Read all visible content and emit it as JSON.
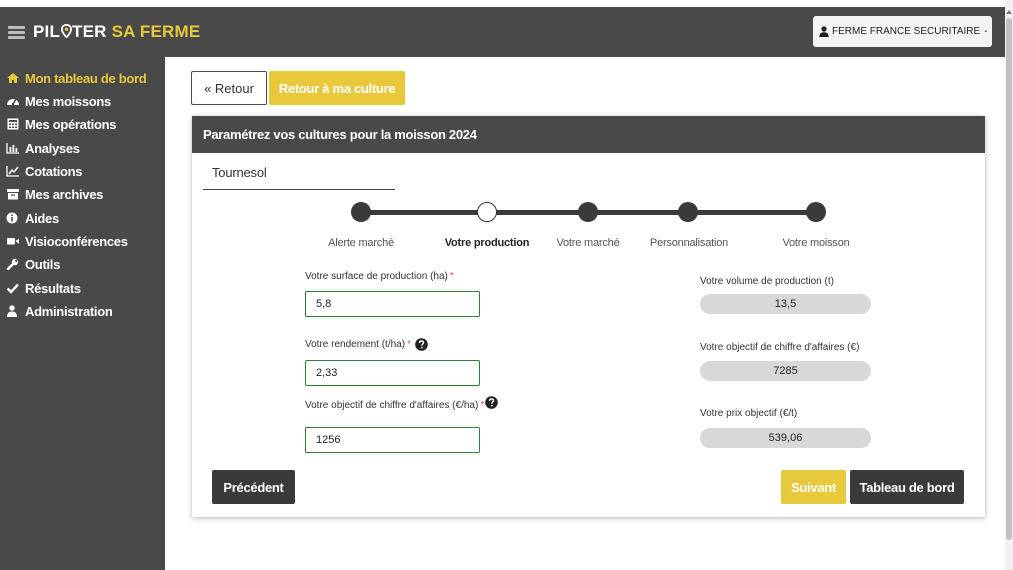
{
  "app": {
    "logo_part1": "PIL",
    "logo_part2": "TER",
    "logo_part3": "SA FERME",
    "user_label": "FERME FRANCE SECURITAIRE",
    "user_caret": "-"
  },
  "sidebar": {
    "items": [
      {
        "label": "Mon tableau de bord",
        "icon": "home-icon"
      },
      {
        "label": "Mes moissons",
        "icon": "dashboard-icon"
      },
      {
        "label": "Mes opérations",
        "icon": "calculator-icon"
      },
      {
        "label": "Analyses",
        "icon": "bar-chart-icon"
      },
      {
        "label": "Cotations",
        "icon": "line-chart-icon"
      },
      {
        "label": "Mes archives",
        "icon": "archive-icon"
      },
      {
        "label": "Aides",
        "icon": "info-icon"
      },
      {
        "label": "Visioconférences",
        "icon": "video-icon"
      },
      {
        "label": "Outils",
        "icon": "wrench-icon"
      },
      {
        "label": "Résultats",
        "icon": "check-icon"
      },
      {
        "label": "Administration",
        "icon": "user-icon"
      }
    ]
  },
  "nav": {
    "back_label": "« Retour",
    "back_to_crop_label": "Retour à ma culture"
  },
  "card": {
    "title": "Paramétrez vos cultures pour la moisson 2024",
    "crop_tab": "Tournesol"
  },
  "steps": [
    {
      "label": "Alerte marché",
      "state": "done"
    },
    {
      "label": "Votre production",
      "state": "current"
    },
    {
      "label": "Votre marché",
      "state": "done"
    },
    {
      "label": "Personnalisation",
      "state": "done"
    },
    {
      "label": "Votre moisson",
      "state": "done"
    }
  ],
  "form": {
    "surface": {
      "label": "Votre surface de production (ha)",
      "required": "*",
      "value": "5,8"
    },
    "rendement": {
      "label": "Votre rendement (t/ha)",
      "required": "*",
      "value": "2,33"
    },
    "objectif_ca_ha": {
      "label": "Votre objectif de chiffre d'affaires (€/ha)",
      "required": "*",
      "value": "1256"
    }
  },
  "outputs": {
    "volume": {
      "label": "Votre volume de production (t)",
      "value": "13,5"
    },
    "objectif_ca": {
      "label": "Votre objectif de chiffre d'affaires (€)",
      "value": "7285"
    },
    "prix_objectif": {
      "label": "Votre prix objectif (€/t)",
      "value": "539,06"
    }
  },
  "actions": {
    "previous": "Précédent",
    "next": "Suivant",
    "dashboard": "Tableau de bord"
  },
  "colors": {
    "accent": "#e8c93b",
    "dark": "#494949",
    "input_border": "#2e7d32",
    "required": "#d9534f"
  }
}
